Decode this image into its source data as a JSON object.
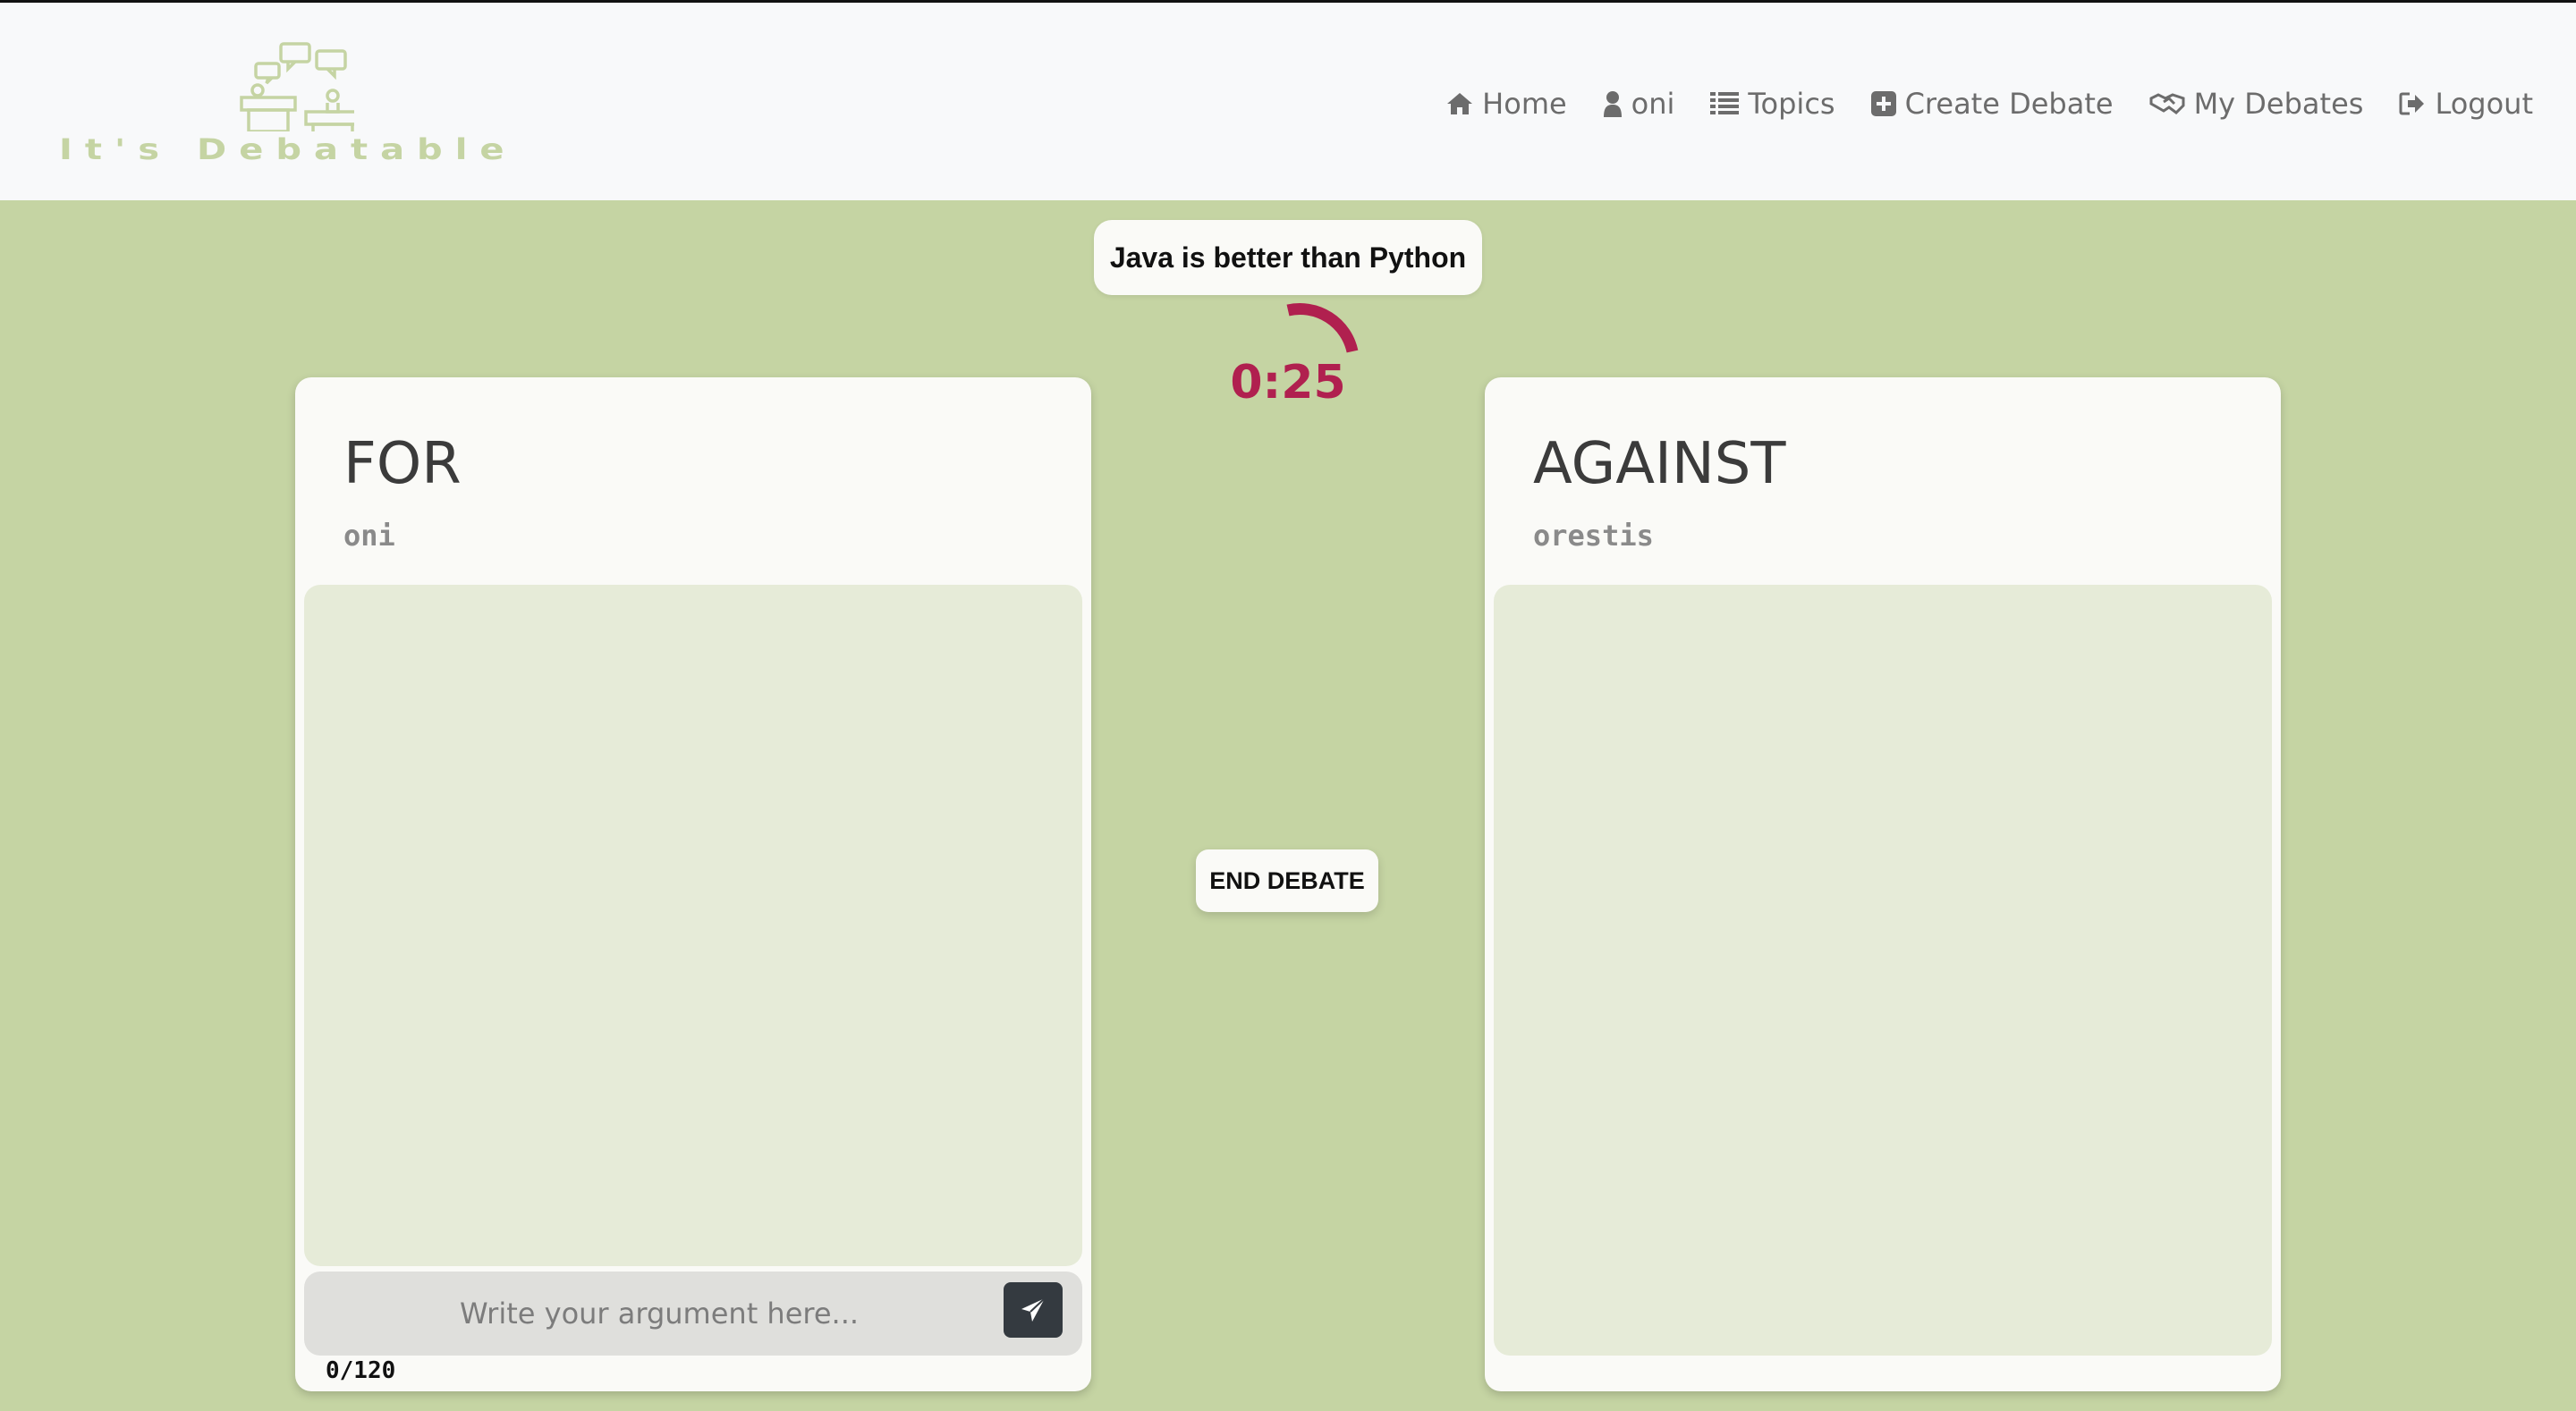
{
  "brand": {
    "name": "It's Debatable",
    "logo_icon": "debate-podiums-icon"
  },
  "nav": [
    {
      "label": "Home",
      "icon": "home-icon"
    },
    {
      "label": "oni",
      "icon": "user-icon"
    },
    {
      "label": "Topics",
      "icon": "list-icon"
    },
    {
      "label": "Create Debate",
      "icon": "plus-square-icon"
    },
    {
      "label": "My Debates",
      "icon": "handshake-icon"
    },
    {
      "label": "Logout",
      "icon": "sign-out-icon"
    }
  ],
  "debate": {
    "topic": "Java is better than Python",
    "timer": "0:25",
    "end_label": "END DEBATE",
    "for": {
      "title": "FOR",
      "user": "oni",
      "input_placeholder": "Write your argument here...",
      "char_count": "0/120"
    },
    "against": {
      "title": "AGAINST",
      "user": "orestis"
    }
  },
  "colors": {
    "background": "#c5d4a3",
    "panel": "#fafaf7",
    "argument_area": "#e6ebd8",
    "timer": "#b0204f",
    "send_button": "#343a40"
  }
}
